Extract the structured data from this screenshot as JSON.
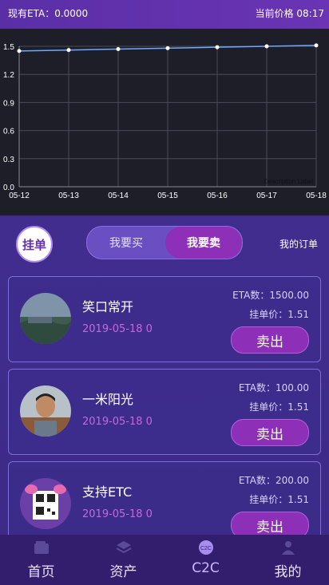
{
  "status_bar": {
    "eta_label": "现有ETA：0.0000",
    "right_text": "当前价格 08:17"
  },
  "chart_data": {
    "type": "line",
    "x": [
      "05-12",
      "05-13",
      "05-14",
      "05-15",
      "05-16",
      "05-17",
      "05-18"
    ],
    "values": [
      1.45,
      1.46,
      1.47,
      1.48,
      1.49,
      1.5,
      1.51
    ],
    "ylim": [
      0,
      1.5
    ],
    "yticks": [
      "0.0",
      "0.3",
      "0.6",
      "0.9",
      "1.2",
      "1.5"
    ],
    "description_label": "Description Label",
    "grid": true,
    "colors": {
      "line": "#6fa8ff",
      "point": "#ffffff",
      "grid": "#4a4a58"
    }
  },
  "controls": {
    "post_label": "挂单",
    "buy_tab": "我要买",
    "sell_tab": "我要卖",
    "my_orders": "我的订单"
  },
  "orders": [
    {
      "name": "笑口常开",
      "date": "2019-05-18 0",
      "qty": "ETA数：1500.00",
      "price": "挂单价：1.51",
      "action": "卖出"
    },
    {
      "name": "一米阳光",
      "date": "2019-05-18 0",
      "qty": "ETA数：100.00",
      "price": "挂单价：1.51",
      "action": "卖出"
    },
    {
      "name": "支持ETC",
      "date": "2019-05-18 0",
      "qty": "ETA数：200.00",
      "price": "挂单价：1.51",
      "action": "卖出"
    }
  ],
  "tabs": [
    {
      "label": "首页",
      "icon": "wallet-icon"
    },
    {
      "label": "资产",
      "icon": "layers-icon"
    },
    {
      "label": "C2C",
      "icon": "c2c-icon"
    },
    {
      "label": "我的",
      "icon": "person-icon"
    }
  ]
}
